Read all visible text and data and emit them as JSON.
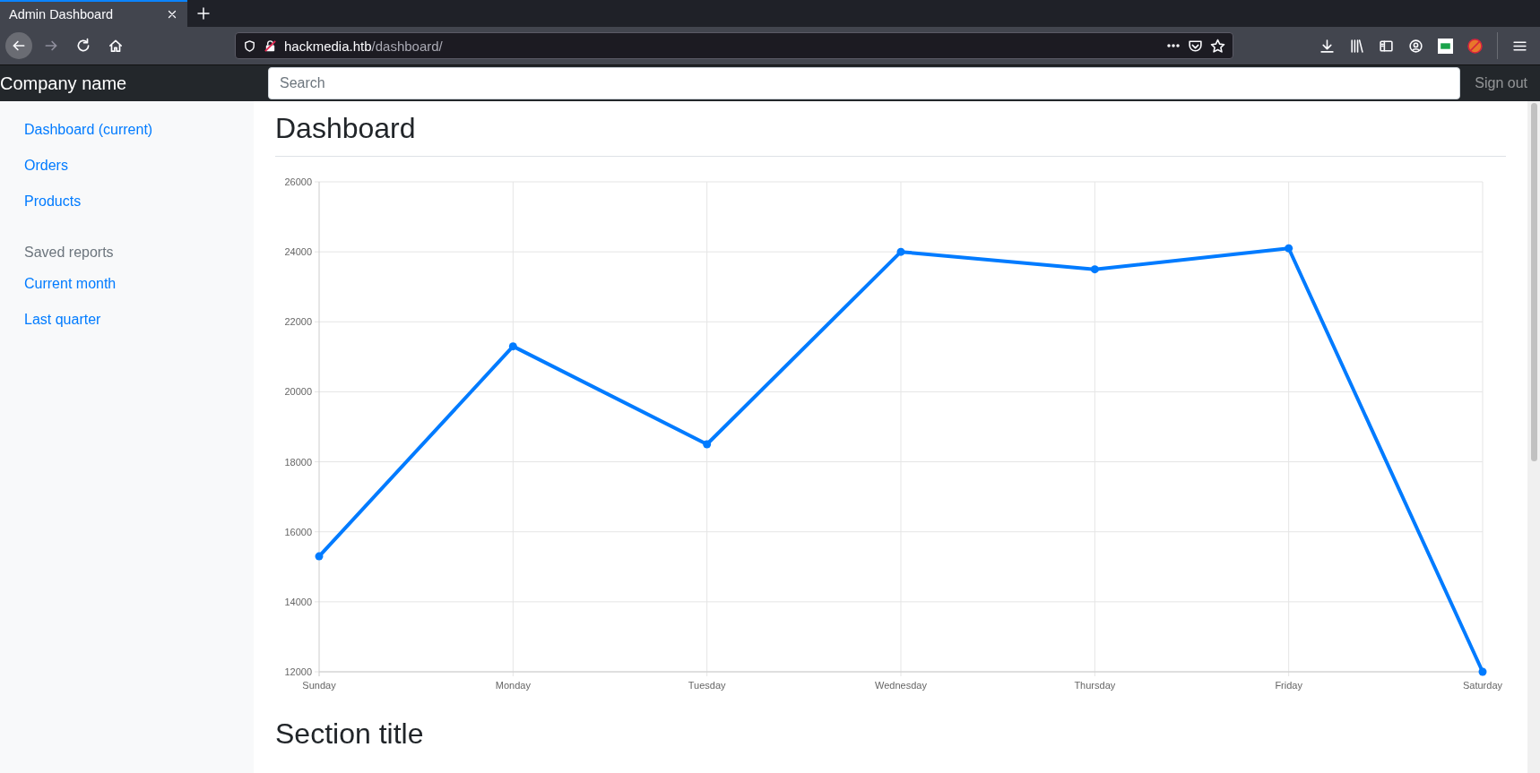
{
  "browser": {
    "tab": {
      "title": "Admin Dashboard",
      "selected": true
    },
    "nav_buttons": [
      {
        "kind": "back",
        "disabled": false
      },
      {
        "kind": "forward",
        "disabled": true
      },
      {
        "kind": "reload",
        "disabled": false
      },
      {
        "kind": "home",
        "disabled": false
      }
    ],
    "address": {
      "host": "hackmedia.htb",
      "path": "/dashboard/"
    }
  },
  "navbar": {
    "brand": "Company name",
    "search": {
      "placeholder": "Search"
    },
    "sign_out": "Sign out"
  },
  "sidebar": {
    "items": [
      {
        "label": "Dashboard (current)"
      },
      {
        "label": "Orders"
      },
      {
        "label": "Products"
      }
    ],
    "saved_reports": {
      "heading": "Saved reports",
      "items": [
        {
          "label": "Current month"
        },
        {
          "label": "Last quarter"
        }
      ]
    }
  },
  "main": {
    "title": "Dashboard",
    "chart_data": {
      "type": "line",
      "categories": [
        "Sunday",
        "Monday",
        "Tuesday",
        "Wednesday",
        "Thursday",
        "Friday",
        "Saturday"
      ],
      "series": [
        {
          "color": "#007bff",
          "marker": true,
          "values": [
            15300,
            21300,
            18500,
            24000,
            23500,
            24100,
            12000
          ]
        }
      ],
      "grid": true,
      "ylim": [
        12000,
        26000
      ],
      "yticks": [
        12000,
        14000,
        16000,
        18000,
        20000,
        22000,
        24000,
        26000
      ]
    },
    "section_title": "Section title"
  }
}
